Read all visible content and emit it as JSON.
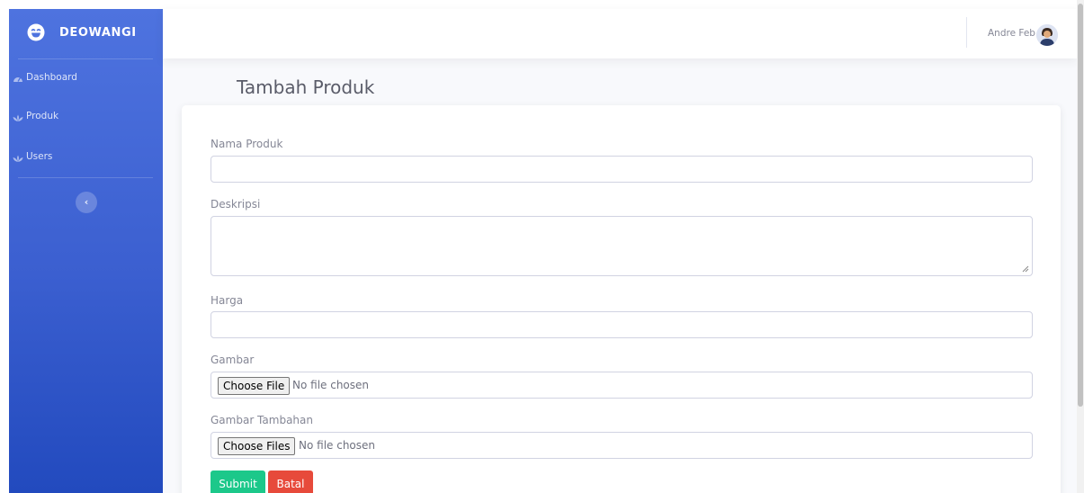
{
  "brand": {
    "name": "DEOWANGI",
    "icon": "laugh-wink-icon"
  },
  "sidebar": {
    "items": [
      {
        "label": "Dashboard",
        "icon": "tachometer-icon"
      },
      {
        "label": "Produk",
        "icon": "leaf-icon"
      },
      {
        "label": "Users",
        "icon": "leaf-icon"
      }
    ],
    "toggle_label": "‹"
  },
  "topbar": {
    "user_name": "Andre Feb",
    "avatar_icon": "user-avatar-icon"
  },
  "page": {
    "title": "Tambah Produk"
  },
  "form": {
    "nama_label": "Nama Produk",
    "nama_value": "",
    "deskripsi_label": "Deskripsi",
    "deskripsi_value": "",
    "harga_label": "Harga",
    "harga_value": "",
    "gambar_label": "Gambar",
    "gambar_button": "Choose File",
    "gambar_status": "No file chosen",
    "gambar_tambahan_label": "Gambar Tambahan",
    "gambar_tambahan_button": "Choose Files",
    "gambar_tambahan_status": "No file chosen",
    "submit_label": "Submit",
    "batal_label": "Batal"
  },
  "colors": {
    "sidebar_top": "#4e73df",
    "sidebar_bottom": "#224abe",
    "submit": "#1cc88a",
    "batal": "#e74a3b",
    "text_muted": "#858796"
  }
}
